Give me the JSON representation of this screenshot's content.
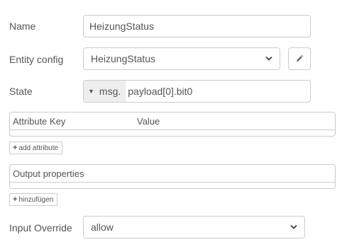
{
  "name": {
    "label": "Name",
    "value": "HeizungStatus"
  },
  "entity_config": {
    "label": "Entity config",
    "selected": "HeizungStatus",
    "edit_icon": "pencil-icon"
  },
  "state": {
    "label": "State",
    "type": "msg.",
    "value": "payload[0].bit0"
  },
  "attributes": {
    "col_key": "Attribute Key",
    "col_value": "Value",
    "add_label": "add attribute"
  },
  "output_properties": {
    "header": "Output properties",
    "add_label": "hinzufügen"
  },
  "input_override": {
    "label": "Input Override",
    "selected": "allow"
  }
}
